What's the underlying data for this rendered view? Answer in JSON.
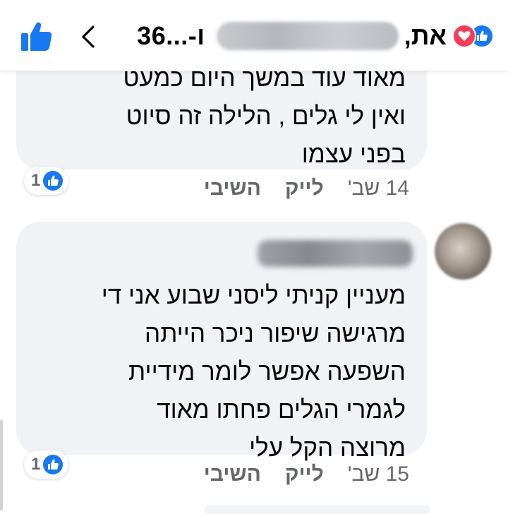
{
  "header": {
    "like_icon": "thumbs-up-icon",
    "back_icon": "chevron-left-icon",
    "count_text": "36...-ו",
    "and_text": "את,",
    "reactions": [
      "heart",
      "like"
    ]
  },
  "comments": [
    {
      "text": "מאוד עוד במשך היום כמעט\nואין לי גלים , הלילה זה סיוט\nבפני עצמו",
      "reaction_count": "1",
      "time": "14 שב'",
      "like_label": "לייק",
      "reply_label": "השיבי"
    },
    {
      "text": "מעניין קניתי ליסני שבוע אני די\nמרגישה שיפור ניכר הייתה\nהשפעה אפשר לומר מידיית\nלגמרי הגלים פחתו מאוד\nמרוצה הקל עלי",
      "reaction_count": "1",
      "time": "15 שב'",
      "like_label": "לייק",
      "reply_label": "השיבי"
    }
  ],
  "colors": {
    "facebook_blue": "#1877f2",
    "heart_red": "#f33e58",
    "bubble_bg": "#f0f2f5",
    "meta_gray": "#65676b"
  }
}
